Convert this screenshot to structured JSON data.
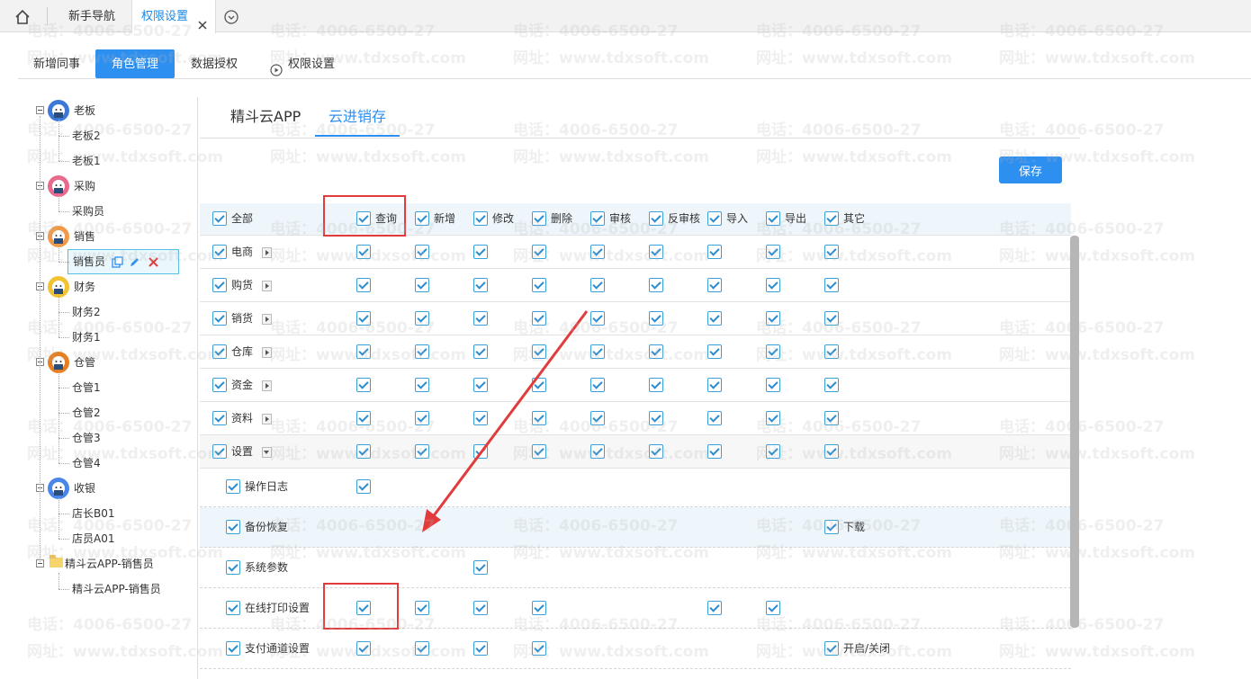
{
  "top_tabs": {
    "guide": "新手导航",
    "permission": "权限设置"
  },
  "subnav": [
    "新增同事",
    "角色管理",
    "数据授权",
    "权限设置"
  ],
  "tree": [
    {
      "label": "老板",
      "avatar": "#3b78d8",
      "children": [
        "老板2",
        "老板1"
      ]
    },
    {
      "label": "采购",
      "avatar": "#e86a8c",
      "children": [
        "采购员"
      ]
    },
    {
      "label": "销售",
      "avatar": "#f09a4a",
      "children": [
        "销售员"
      ]
    },
    {
      "label": "财务",
      "avatar": "#f1c232",
      "children": [
        "财务2",
        "财务1"
      ]
    },
    {
      "label": "仓管",
      "avatar": "#e67e22",
      "children": [
        "仓管1",
        "仓管2",
        "仓管3",
        "仓管4"
      ]
    },
    {
      "label": "收银",
      "avatar": "#4a86e8",
      "children": [
        "店长B01",
        "店员A01"
      ]
    },
    {
      "label": "精斗云APP-销售员",
      "folder": true,
      "children": [
        "精斗云APP-销售员"
      ]
    }
  ],
  "app_tabs": [
    "精斗云APP",
    "云进销存"
  ],
  "save_label": "保存",
  "header_row": {
    "label": "全部",
    "columns": [
      "查询",
      "新增",
      "修改",
      "删除",
      "审核",
      "反审核",
      "导入",
      "导出",
      "其它"
    ]
  },
  "modules": [
    {
      "label": "电商",
      "cols": [
        0,
        1,
        2,
        3,
        4,
        5,
        6,
        7,
        8
      ]
    },
    {
      "label": "购货",
      "cols": [
        0,
        1,
        2,
        3,
        4,
        5,
        6,
        7,
        8
      ]
    },
    {
      "label": "销货",
      "cols": [
        0,
        1,
        2,
        3,
        4,
        5,
        6,
        7,
        8
      ]
    },
    {
      "label": "仓库",
      "cols": [
        0,
        1,
        2,
        3,
        4,
        5,
        6,
        7,
        8
      ]
    },
    {
      "label": "资金",
      "cols": [
        0,
        1,
        2,
        3,
        4,
        5,
        6,
        7,
        8
      ]
    },
    {
      "label": "资料",
      "cols": [
        0,
        1,
        2,
        3,
        4,
        5,
        6,
        7,
        8
      ]
    },
    {
      "label": "设置",
      "cols": [
        0,
        1,
        2,
        3,
        4,
        5,
        6,
        7,
        8
      ],
      "expanded": true
    }
  ],
  "sub_items": [
    {
      "label": "操作日志",
      "cols": [
        0
      ]
    },
    {
      "label": "备份恢复",
      "cols": [],
      "extra": "下载"
    },
    {
      "label": "系统参数",
      "cols": [
        2
      ]
    },
    {
      "label": "在线打印设置",
      "cols": [
        0,
        1,
        2,
        3,
        6,
        7
      ]
    },
    {
      "label": "支付通道设置",
      "cols": [
        0,
        1,
        2,
        3
      ],
      "extra": "开启/关闭"
    }
  ],
  "watermark": {
    "phone": "电话：4006-6500-27",
    "site": "网址：www.tdxsoft.com"
  },
  "colors": {
    "accent": "#2d8ff0",
    "annotation": "#e23b3b"
  }
}
